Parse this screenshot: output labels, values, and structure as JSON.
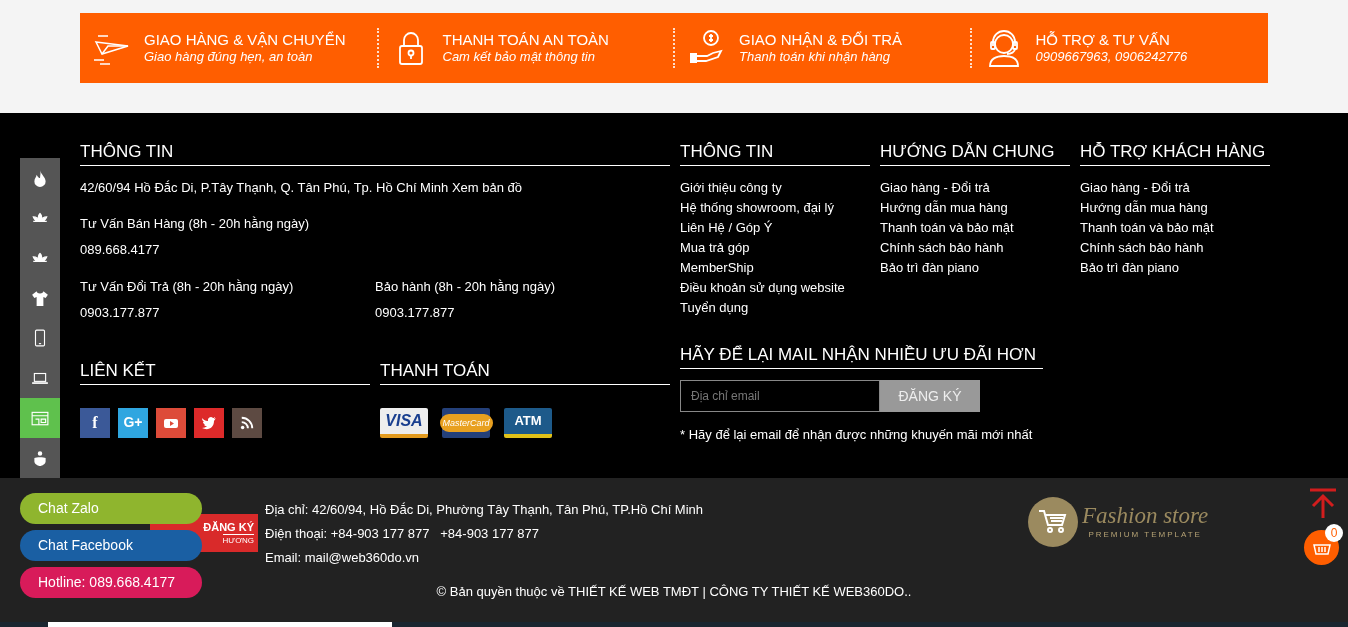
{
  "features": [
    {
      "title": "GIAO HÀNG & VẬN CHUYỂN",
      "subtitle": "Giao hàng đúng hẹn, an toàn"
    },
    {
      "title": "THANH TOÁN AN TOÀN",
      "subtitle": "Cam kết bảo mật thông tin"
    },
    {
      "title": "GIAO NHẬN & ĐỔI TRẢ",
      "subtitle": "Thanh toán khi nhận hàng"
    },
    {
      "title": "HỖ TRỢ & TƯ VẤN",
      "subtitle": "0909667963, 0906242776"
    }
  ],
  "sidebar": {
    "items": [
      {
        "selected": false
      },
      {
        "selected": false
      },
      {
        "selected": false
      },
      {
        "selected": false
      },
      {
        "selected": false
      },
      {
        "selected": false
      },
      {
        "selected": true
      },
      {
        "selected": false
      }
    ]
  },
  "contact": {
    "heading": "THÔNG TIN",
    "address": "42/60/94 Hồ Đắc Di, P.Tây Thạnh, Q. Tân Phú, Tp. Hồ Chí Minh",
    "map_link": "Xem bản đồ",
    "sales": {
      "label": "Tư Vấn Bán Hàng (8h - 20h hằng ngày)",
      "phone": "089.668.4177"
    },
    "returns": {
      "label": "Tư Vấn Đổi Trả (8h - 20h hằng ngày)",
      "phone": "0903.177.877"
    },
    "warranty": {
      "label": "Bảo hành (8h - 20h hằng ngày)",
      "phone": "0903.177.877"
    }
  },
  "links": {
    "heading": "LIÊN KẾT",
    "social": [
      {
        "kind": "facebook",
        "label": "f",
        "color": "#3b5998"
      },
      {
        "kind": "google",
        "label": "G+",
        "color": "#2fa6e0"
      },
      {
        "kind": "youtube",
        "color": "#dd4b39"
      },
      {
        "kind": "twitter",
        "color": "#dd2a2a"
      },
      {
        "kind": "rss",
        "color": "#5d4a42"
      }
    ]
  },
  "payment": {
    "heading": "THANH TOÁN",
    "cards": [
      "VISA",
      "MasterCard",
      "ATM"
    ]
  },
  "columns": [
    {
      "heading": "THÔNG TIN",
      "items": [
        "Giới thiệu công ty",
        "Hệ thống showroom, đại lý",
        "Liên Hệ / Góp Ý",
        "Mua trả góp",
        "MemberShip",
        "Điều khoản sử dụng website",
        "Tuyển dụng"
      ]
    },
    {
      "heading": "HƯỚNG DẪN CHUNG",
      "items": [
        "Giao hàng - Đổi trả",
        "Hướng dẫn mua hàng",
        "Thanh toán và bảo mật",
        "Chính sách bảo hành",
        "Bảo trì đàn piano"
      ]
    },
    {
      "heading": "HỖ TRỢ KHÁCH HÀNG",
      "items": [
        "Giao hàng - Đổi trả",
        "Hướng dẫn mua hàng",
        "Thanh toán và bảo mật",
        "Chính sách bảo hành",
        "Bảo trì đàn piano"
      ]
    }
  ],
  "newsletter": {
    "heading": "HÃY ĐỂ LẠI MAIL NHẬN NHIỀU ƯU ĐÃI HƠN",
    "placeholder": "Địa chỉ email",
    "button": "ĐĂNG KÝ",
    "note": "* Hãy để lại email để nhận được những khuyến mãi mới nhất"
  },
  "footer": {
    "badge": [
      "ĐĂNG KÝ",
      "HƯƠNG"
    ],
    "lines": [
      "Địa chỉ: 42/60/94, Hồ Đắc Di, Phường Tây Thạnh, Tân Phú, TP.Hồ Chí Minh",
      "Điện thoại: +84-903 177 877   +84-903 177 877",
      "Email: mail@web360do.vn"
    ],
    "copyright": "© Bản quyền thuộc về THIẾT KẾ WEB TMĐT | CÔNG TY THIẾT KẾ WEB360DO..",
    "logo": {
      "name": "Fashion store",
      "tagline": "PREMIUM TEMPLATE"
    }
  },
  "chat_buttons": [
    {
      "label": "Chat Zalo",
      "color": "#8fb52e"
    },
    {
      "label": "Chat Facebook",
      "color": "#1a5fa3"
    },
    {
      "label": "Hotline: 089.668.4177",
      "color": "#d81b5a"
    }
  ],
  "cart": {
    "count": "0"
  }
}
